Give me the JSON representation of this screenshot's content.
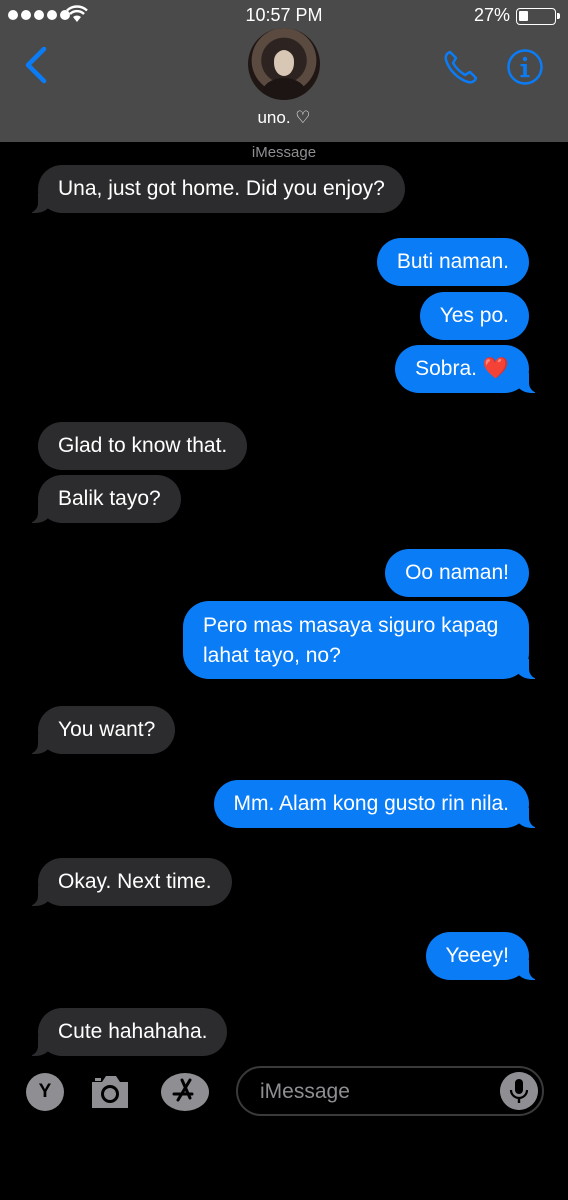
{
  "status_bar": {
    "time": "10:57 PM",
    "battery": "27%",
    "battery_level": 0.27
  },
  "header": {
    "contact_name": "uno. ♡"
  },
  "service_label": "iMessage",
  "messages": [
    {
      "dir": "in",
      "text": "Una, just got home. Did you enjoy?"
    },
    {
      "dir": "out",
      "text": "Buti naman."
    },
    {
      "dir": "out",
      "text": "Yes po."
    },
    {
      "dir": "out",
      "text": "Sobra.",
      "emoji": "❤️"
    },
    {
      "dir": "in",
      "text": "Glad to know that."
    },
    {
      "dir": "in",
      "text": "Balik tayo?"
    },
    {
      "dir": "out",
      "text": "Oo naman!"
    },
    {
      "dir": "out",
      "text": "Pero mas masaya siguro kapag lahat tayo, no?"
    },
    {
      "dir": "in",
      "text": "You want?"
    },
    {
      "dir": "out",
      "text": "Mm. Alam kong gusto rin nila."
    },
    {
      "dir": "in",
      "text": "Okay. Next time."
    },
    {
      "dir": "out",
      "text": "Yeeey!"
    },
    {
      "dir": "in",
      "text": "Cute hahahaha."
    }
  ],
  "input": {
    "placeholder": "iMessage",
    "apps_label": "Y"
  },
  "icons": {
    "back": "chevron-left-icon",
    "phone": "phone-icon",
    "info": "info-icon",
    "camera": "camera-icon",
    "appstore": "app-store-icon",
    "mic": "microphone-icon"
  },
  "colors": {
    "accent": "#0a7cf6",
    "incoming_bubble": "#2c2c2e",
    "header": "#4a4a4a"
  }
}
